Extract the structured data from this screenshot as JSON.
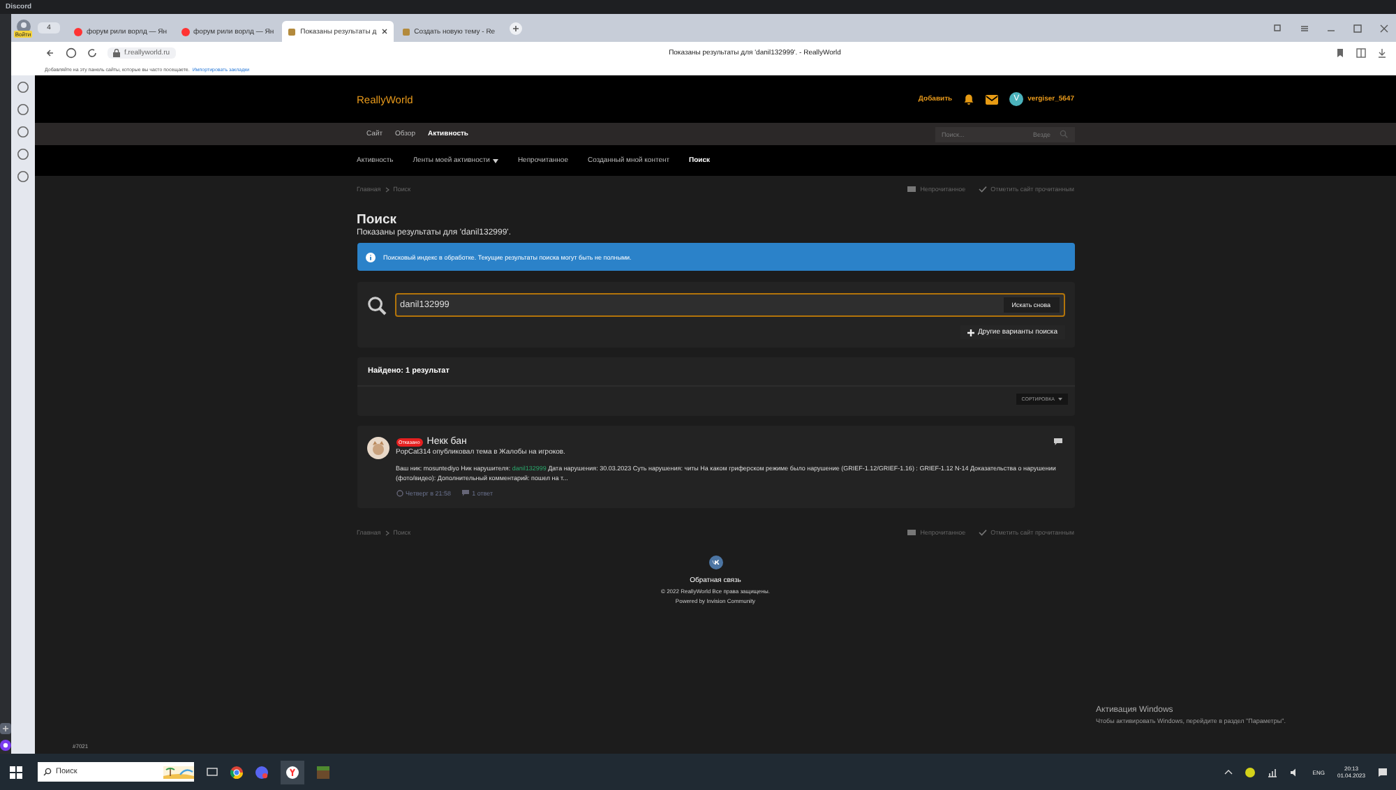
{
  "discord": {
    "title": "Discord",
    "user_tag": "#7021"
  },
  "browser": {
    "profile_badge": "Войти",
    "tab_count": "4",
    "tabs": [
      {
        "title": "форум рили ворлд — Ян",
        "selected": false
      },
      {
        "title": "форум рили ворлд — Ян",
        "selected": false
      },
      {
        "title": "Показаны результаты д",
        "selected": true
      },
      {
        "title": "Создать новую тему - Re",
        "selected": false
      }
    ],
    "address": "f.reallyworld.ru",
    "page_title": "Показаны результаты для 'danil132999'. - ReallyWorld",
    "bookmarks_hint": "Добавляйте на эту панель сайты, которые вы часто посещаете.",
    "bookmarks_link": "Импортировать закладки"
  },
  "site": {
    "logo": "ReallyWorld",
    "add": "Добавить",
    "user_initial": "V",
    "username": "vergiser_5647",
    "nav": [
      {
        "label": "Сайт",
        "selected": false
      },
      {
        "label": "Обзор",
        "selected": false
      },
      {
        "label": "Активность",
        "selected": true
      }
    ],
    "search_placeholder": "Поиск...",
    "search_scope": "Везде",
    "subnav": [
      {
        "label": "Активность",
        "selected": false,
        "dropdown": false
      },
      {
        "label": "Ленты моей активности",
        "selected": false,
        "dropdown": true
      },
      {
        "label": "Непрочитанное",
        "selected": false,
        "dropdown": false
      },
      {
        "label": "Созданный мной контент",
        "selected": false,
        "dropdown": false
      },
      {
        "label": "Поиск",
        "selected": true,
        "dropdown": false
      }
    ],
    "breadcrumb": [
      "Главная",
      "Поиск"
    ],
    "actions": [
      "Непрочитанное",
      "Отметить сайт прочитанным"
    ],
    "heading": "Поиск",
    "subheading": "Показаны результаты для 'danil132999'.",
    "notice": "Поисковый индекс в обработке. Текущие результаты поиска могут быть не полными.",
    "query": "danil132999",
    "search_again": "Искать снова",
    "more_options": "Другие варианты поиска",
    "found": "Найдено: 1 результат",
    "sort": "СОРТИРОВКА",
    "results": [
      {
        "badge": "Отказано",
        "title": "Некк бан",
        "meta": "PopCat314 опубликовал тема в Жалобы на игроков.",
        "snippet": {
          "before": "Ваш ник: mosuntediyo Ник нарушителя: ",
          "highlight": "danil132999",
          "after": " Дата нарушения: 30.03.2023 Суть нарушения: читы На каком гриферском режиме было нарушение (GRIEF-1.12/GRIEF-1.16) : GRIEF-1.12 N-14 Доказательства о нарушении (фото/видео): Дополнительный комментарий: пошел на т..."
        },
        "time": "Четверг в 21:58",
        "replies": "1 ответ"
      }
    ],
    "footer": {
      "breadcrumb": [
        "Главная",
        "Поиск"
      ],
      "actions": [
        "Непрочитанное",
        "Отметить сайт прочитанным"
      ],
      "feedback": "Обратная связь",
      "copyright": "© 2022 ReallyWorld Все права защищены.",
      "powered": "Powered by Invision Community"
    }
  },
  "windows": {
    "activation_title": "Активация Windows",
    "activation_text": "Чтобы активировать Windows, перейдите в раздел \"Параметры\"."
  },
  "taskbar": {
    "search": "Поиск",
    "language": "ENG",
    "time": "20:13",
    "date": "01.04.2023"
  }
}
